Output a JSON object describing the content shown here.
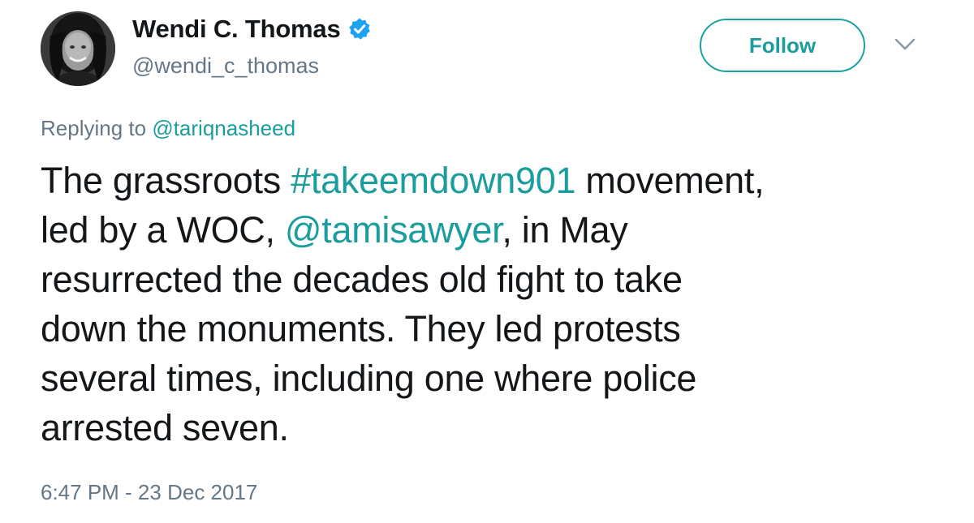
{
  "author": {
    "display_name": "Wendi C. Thomas",
    "handle": "@wendi_c_thomas",
    "verified_icon": "verified-badge-icon",
    "avatar_icon": "profile-photo"
  },
  "header": {
    "follow_label": "Follow",
    "menu_icon": "chevron-down-icon"
  },
  "reply": {
    "prefix": "Replying to",
    "mention": "@tariqnasheed"
  },
  "tweet": {
    "line1_a": "The grassroots ",
    "line1_hashtag": "#takeemdown901",
    "line1_b": " movement,",
    "line2_a": "led by a WOC, ",
    "line2_mention": "@tamisawyer",
    "line2_b": ", in May",
    "line3": "resurrected the decades old fight to take",
    "line4": "down the monuments. They led protests",
    "line5": "several times, including one where police",
    "line6": "arrested seven."
  },
  "timestamp": "6:47 PM - 23 Dec 2017",
  "colors": {
    "accent": "#1b9c9d",
    "text": "#14171a",
    "secondary": "#657786",
    "verified": "#1da1f2"
  }
}
